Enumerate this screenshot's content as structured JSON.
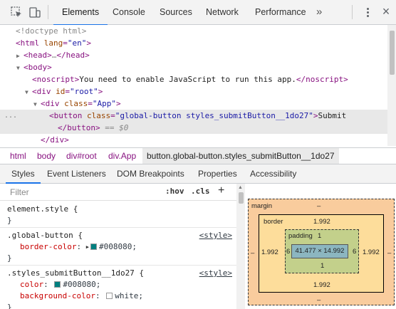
{
  "toolbar": {
    "tabs": [
      "Elements",
      "Console",
      "Sources",
      "Network",
      "Performance"
    ],
    "active_tab": "Elements",
    "more": "»",
    "close": "×",
    "icons": [
      "inspect-element-icon",
      "device-toolbar-icon",
      "kebab-menu-icon",
      "close-icon"
    ]
  },
  "dom_tree": {
    "doctype": "<!doctype html>",
    "html_open_tag": "<html",
    "html_lang_attr": "lang",
    "html_lang_val": "\"en\"",
    "html_close": ">",
    "head_tag": "<head>",
    "head_ellipsis": "…",
    "head_close": "</head>",
    "body_tag": "<body>",
    "noscript_open": "<noscript>",
    "noscript_text": "You need to enable JavaScript to run this app.",
    "noscript_close": "</noscript>",
    "div_open": "<div",
    "id_attr": "id",
    "id_val": "\"root\"",
    "class_attr": "class",
    "class_val_app": "\"App\"",
    "tag_close": ">",
    "button_open": "<button",
    "button_class_val": "\"global-button styles_submitButton__1do27\"",
    "button_text": "Submit",
    "button_close": "</button>",
    "selected_marker": "== $0",
    "div_close": "</div>",
    "row_ellipsis": "..."
  },
  "breadcrumbs": [
    "html",
    "body",
    "div#root",
    "div.App",
    "button.global-button.styles_submitButton__1do27"
  ],
  "subtabs": [
    "Styles",
    "Event Listeners",
    "DOM Breakpoints",
    "Properties",
    "Accessibility"
  ],
  "active_subtab": "Styles",
  "styles_pane": {
    "filter_placeholder": "Filter",
    "hov": ":hov",
    "cls": ".cls",
    "plus": "+",
    "rules": [
      {
        "selector": "element.style {",
        "close": "}",
        "source": ""
      },
      {
        "selector": ".global-button {",
        "source": "<style>",
        "prop1": "border-color",
        "val1": "#008080",
        "colon": ":",
        "semi": ";",
        "close": "}"
      },
      {
        "selector": ".styles_submitButton__1do27 {",
        "source": "<style>",
        "prop1": "color",
        "val1": "#008080",
        "prop2": "background-color",
        "val2": "white",
        "colon": ":",
        "semi": ";",
        "close": "}"
      }
    ],
    "swatch_teal": "#008080",
    "swatch_white": "#ffffff"
  },
  "box_model": {
    "margin_label": "margin",
    "margin_top": "–",
    "margin_bottom": "–",
    "margin_left": "–",
    "margin_right": "–",
    "border_label": "border",
    "border_top": "1.992",
    "border_bottom": "1.992",
    "border_left": "1.992",
    "border_right": "1.992",
    "padding_label": "padding",
    "padding_top": "1",
    "padding_bottom": "1",
    "padding_left": "6",
    "padding_right": "6",
    "content": "41.477 × 14.992"
  },
  "colors": {
    "tag": "#881280",
    "attr": "#994500",
    "value": "#1a1aa6",
    "accent": "#1a73e8",
    "margin": "#f9cc9d",
    "border": "#fddd9b",
    "padding": "#c3d08b",
    "content": "#8cb6c0"
  }
}
